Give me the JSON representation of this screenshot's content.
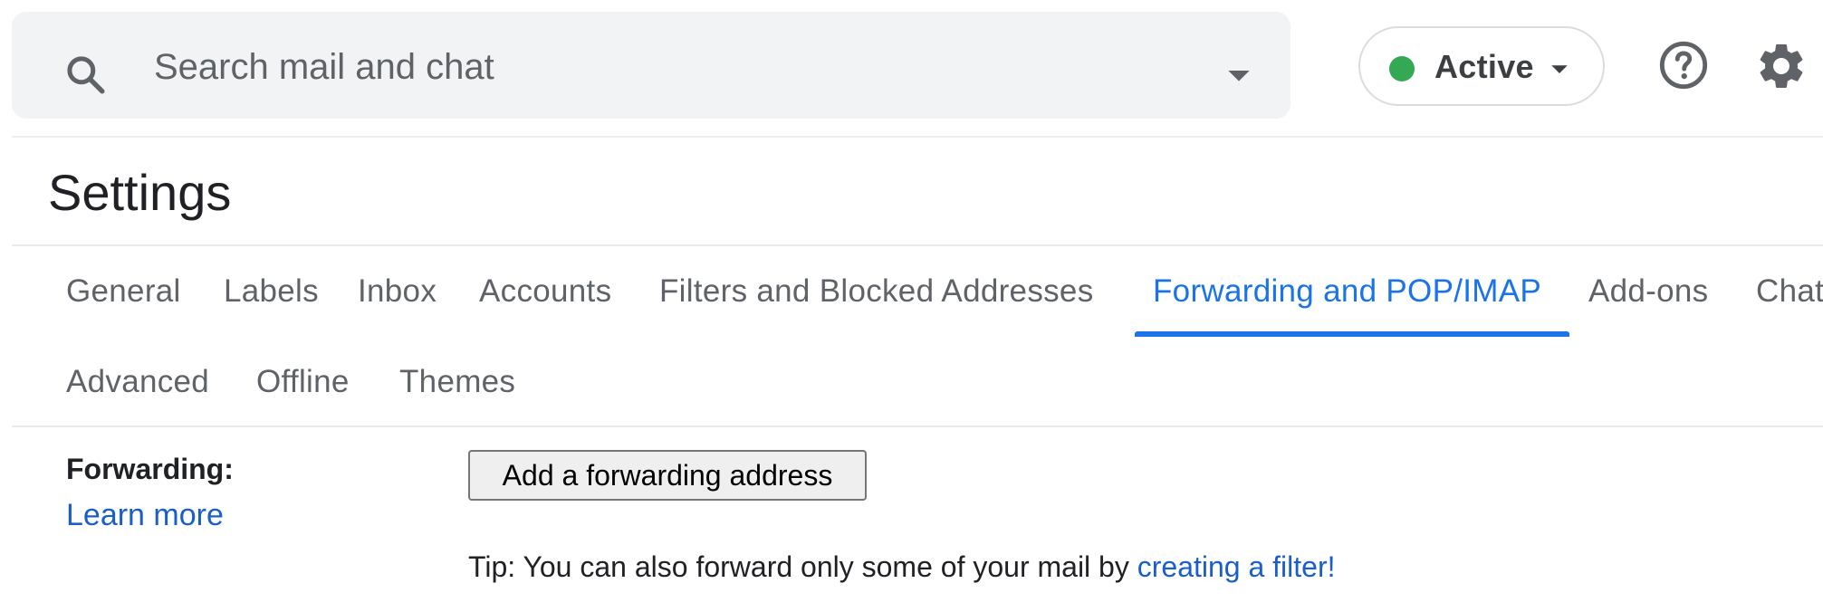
{
  "search": {
    "placeholder": "Search mail and chat"
  },
  "status": {
    "label": "Active",
    "color": "#34a853"
  },
  "page": {
    "title": "Settings"
  },
  "tabs": [
    {
      "label": "General"
    },
    {
      "label": "Labels"
    },
    {
      "label": "Inbox"
    },
    {
      "label": "Accounts"
    },
    {
      "label": "Filters and Blocked Addresses"
    },
    {
      "label": "Forwarding and POP/IMAP",
      "active": true
    },
    {
      "label": "Add-ons"
    },
    {
      "label": "Chat"
    },
    {
      "label": "Advanced"
    },
    {
      "label": "Offline"
    },
    {
      "label": "Themes"
    }
  ],
  "forwarding": {
    "label": "Forwarding:",
    "learn_more": "Learn more",
    "add_button": "Add a forwarding address",
    "tip_prefix": "Tip: You can also forward only some of your mail by ",
    "tip_link": "creating a filter!"
  },
  "colors": {
    "accent": "#1a73e8",
    "link": "#1a5fc8"
  },
  "icons": {
    "search": "search-icon",
    "search_options": "chevron-down-icon",
    "help": "help-icon",
    "settings": "gear-icon"
  }
}
